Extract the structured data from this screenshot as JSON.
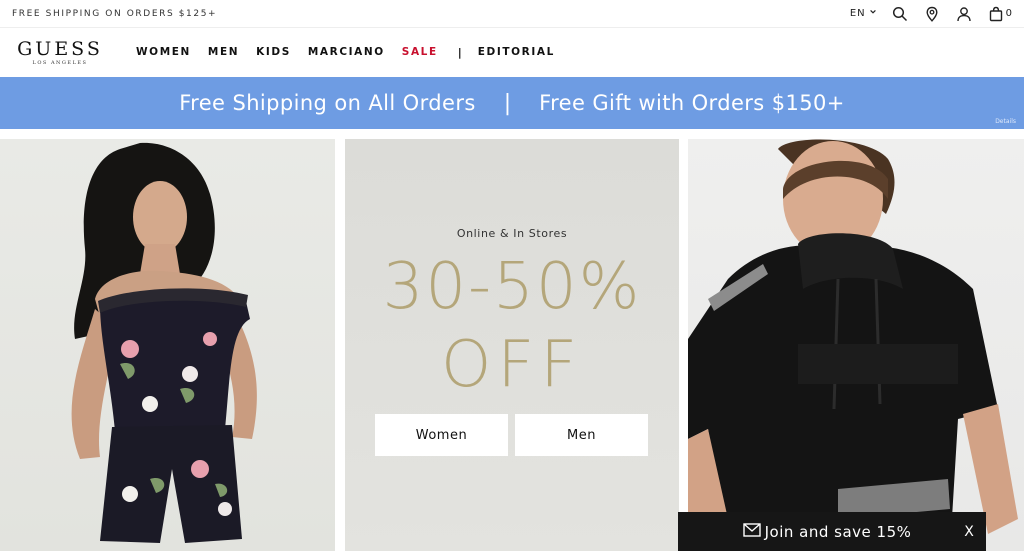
{
  "utility": {
    "promo": "FREE SHIPPING ON ORDERS $125+",
    "language": "EN",
    "bag_count": "0",
    "icons": [
      "chevron-down-icon",
      "search-icon",
      "location-pin-icon",
      "account-icon",
      "shopping-bag-icon"
    ]
  },
  "logo": {
    "word": "GUESS",
    "sub": "LOS ANGELES"
  },
  "nav": {
    "women": "WOMEN",
    "men": "MEN",
    "kids": "KIDS",
    "marciano": "MARCIANO",
    "sale": "SALE",
    "separator": "|",
    "editorial": "EDITORIAL"
  },
  "banner": {
    "left": "Free Shipping on All Orders",
    "divider": "|",
    "right": "Free Gift with Orders $150+",
    "details": "Details",
    "color": "#6e9ce3"
  },
  "hero": {
    "subhead": "Online & In Stores",
    "discount": "30-50%",
    "off": "OFF",
    "cta_women": "Women",
    "cta_men": "Men",
    "accent": "#b4a67a"
  },
  "join": {
    "label": "Join and save 15%",
    "close": "X",
    "icon": "envelope-icon"
  },
  "colors": {
    "sale": "#c8102e"
  }
}
